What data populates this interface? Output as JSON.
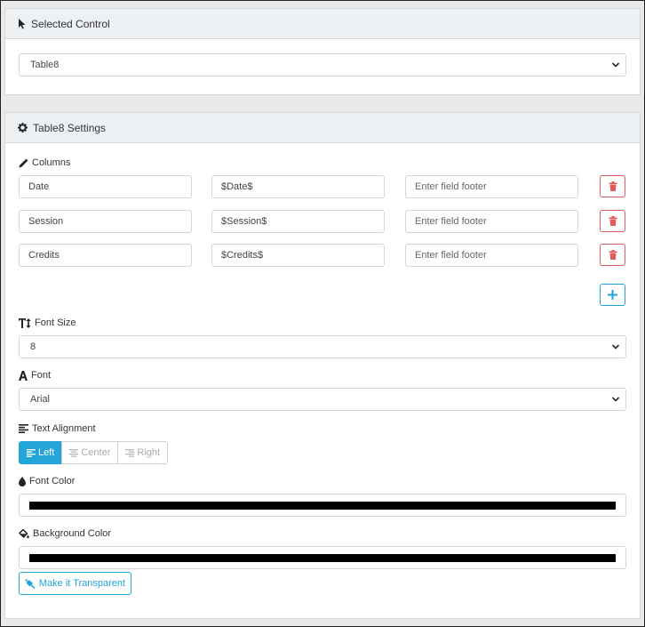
{
  "selected_control": {
    "title": "Selected Control",
    "value": "Table8"
  },
  "settings": {
    "title": "Table8 Settings",
    "columns_label": "Columns",
    "columns": [
      {
        "name": "Date",
        "value": "$Date$",
        "footer_placeholder": "Enter field footer"
      },
      {
        "name": "Session",
        "value": "$Session$",
        "footer_placeholder": "Enter field footer"
      },
      {
        "name": "Credits",
        "value": "$Credits$",
        "footer_placeholder": "Enter field footer"
      }
    ],
    "font_size_label": "Font Size",
    "font_size_value": "8",
    "font_label": "Font",
    "font_value": "Arial",
    "alignment_label": "Text Alignment",
    "alignment_options": [
      "Left",
      "Center",
      "Right"
    ],
    "alignment_selected": "Left",
    "font_color_label": "Font Color",
    "font_color_value": "#000000",
    "background_color_label": "Background Color",
    "background_color_value": "#000000",
    "transparent_button": "Make it Transparent"
  },
  "colors": {
    "accent": "#23a5d9",
    "danger": "#e05b5b",
    "header_bg": "#eef1f4"
  },
  "icons": {
    "selected_control": "cursor-icon",
    "settings": "gear-icon",
    "columns": "pencil-icon",
    "font_size": "text-height-icon",
    "font": "font-icon",
    "alignment": "align-left-icon",
    "font_color": "droplet-icon",
    "background_color": "paint-bucket-icon",
    "delete": "trash-icon",
    "add": "plus-icon",
    "transparent": "no-fill-icon",
    "dropdown": "chevron-down-icon"
  }
}
